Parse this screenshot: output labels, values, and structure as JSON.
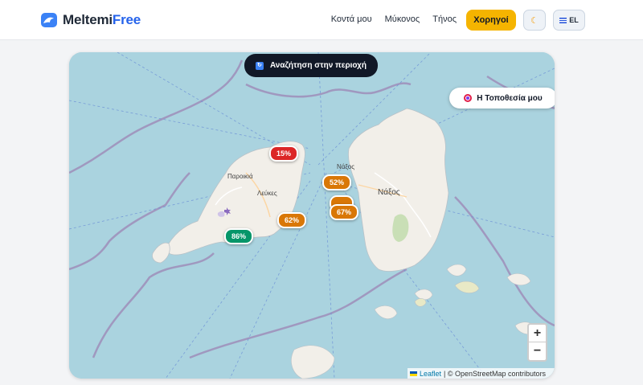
{
  "header": {
    "brand_main": "Meltemi",
    "brand_accent": "Free",
    "nav": [
      {
        "label": "Κοντά μου"
      },
      {
        "label": "Μύκονος"
      },
      {
        "label": "Τήνος"
      }
    ],
    "sponsors_label": "Χορηγοί",
    "theme_icon": "moon-icon",
    "lang_label": "EL"
  },
  "map": {
    "search_label": "Αναζήτηση στην περιοχή",
    "my_location_label": "Η Τοποθεσία μου",
    "zoom_in": "+",
    "zoom_out": "−",
    "attribution_leaflet": "Leaflet",
    "attribution_osm": "| © OpenStreetMap contributors",
    "places": {
      "paroikia": "Παροικιά",
      "lefkes": "Λεύκες",
      "naxos_town": "Νάξος",
      "naxos_island": "Νάξος"
    },
    "markers": [
      {
        "label": "15%",
        "value": 15,
        "color": "red"
      },
      {
        "label": "52%",
        "value": 52,
        "color": "orange"
      },
      {
        "label": "62%",
        "value": 62,
        "color": "orange"
      },
      {
        "label": "67%",
        "value": 67,
        "color": "orange"
      },
      {
        "label": "86%",
        "value": 86,
        "color": "green"
      }
    ]
  },
  "colors": {
    "sea": "#aad3df",
    "land": "#f2efe9",
    "accent_blue": "#2563eb",
    "sponsor_yellow": "#f5b400",
    "marker_red": "#dc2626",
    "marker_orange": "#d97706",
    "marker_green": "#059669"
  }
}
